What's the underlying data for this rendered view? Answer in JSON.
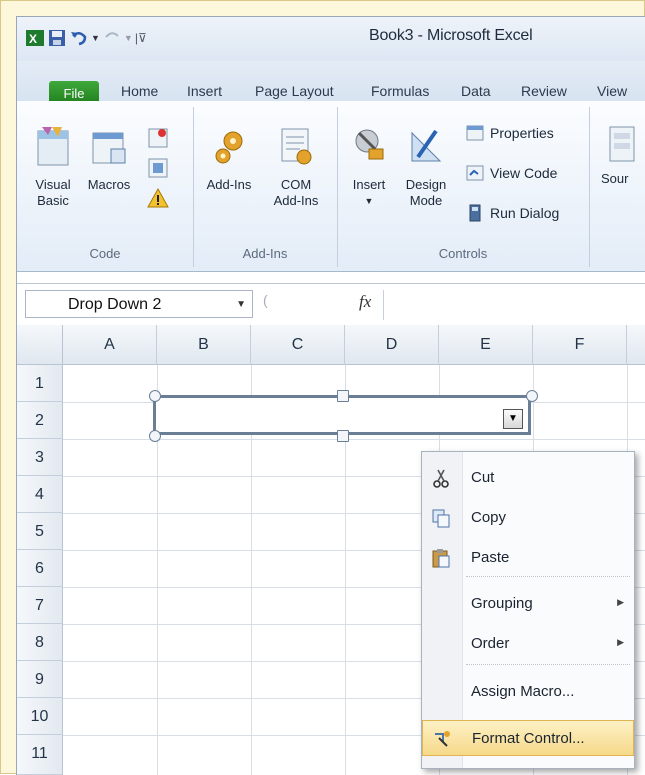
{
  "window": {
    "title": "Book3 - Microsoft Excel"
  },
  "tabs": [
    {
      "label": "File"
    },
    {
      "label": "Home"
    },
    {
      "label": "Insert"
    },
    {
      "label": "Page Layout"
    },
    {
      "label": "Formulas"
    },
    {
      "label": "Data"
    },
    {
      "label": "Review"
    },
    {
      "label": "View"
    }
  ],
  "ribbon": {
    "code": {
      "label": "Code",
      "visual_basic": "Visual Basic",
      "macros": "Macros"
    },
    "addins": {
      "label": "Add-Ins",
      "addins": "Add-Ins",
      "com_addins": "COM Add-Ins"
    },
    "controls": {
      "label": "Controls",
      "insert": "Insert",
      "design_mode": "Design Mode",
      "properties": "Properties",
      "view_code": "View Code",
      "run_dialog": "Run Dialog"
    },
    "source": "Sour"
  },
  "formula_bar": {
    "name_box": "Drop Down 2",
    "fx": "fx",
    "formula": ""
  },
  "columns": [
    "A",
    "B",
    "C",
    "D",
    "E",
    "F"
  ],
  "rows": [
    "1",
    "2",
    "3",
    "4",
    "5",
    "6",
    "7",
    "8",
    "9",
    "10",
    "11"
  ],
  "context_menu": {
    "cut": "Cut",
    "copy": "Copy",
    "paste": "Paste",
    "grouping": "Grouping",
    "order": "Order",
    "assign_macro": "Assign Macro...",
    "format_control": "Format Control..."
  },
  "colors": {
    "file_tab": "#2a8f27",
    "highlight": "#f6d98a",
    "selection_border": "#6a7f95"
  }
}
